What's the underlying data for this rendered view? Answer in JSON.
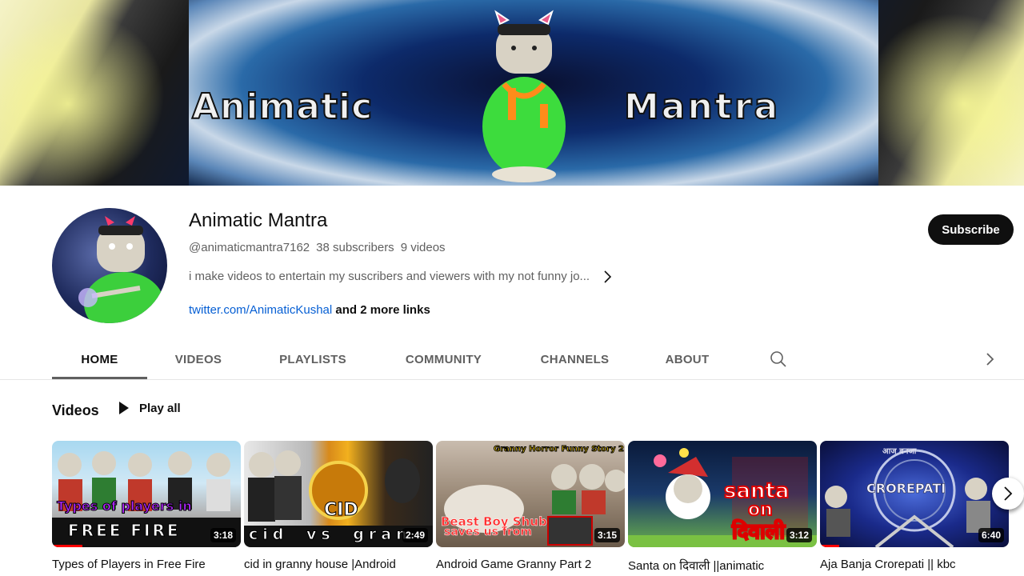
{
  "banner": {
    "word_left": "Animatic",
    "word_right": "Mantra"
  },
  "channel": {
    "name": "Animatic Mantra",
    "handle": "@animaticmantra7162",
    "subscribers": "38 subscribers",
    "videos_count": "9 videos",
    "description": "i make videos to entertain my suscribers and viewers with my not funny jo...",
    "link_text": "twitter.com/AnimaticKushal",
    "more_links": "and 2 more links",
    "subscribe_label": "Subscribe"
  },
  "tabs": [
    {
      "label": "HOME",
      "active": true
    },
    {
      "label": "VIDEOS"
    },
    {
      "label": "PLAYLISTS"
    },
    {
      "label": "COMMUNITY"
    },
    {
      "label": "CHANNELS"
    },
    {
      "label": "ABOUT"
    }
  ],
  "section": {
    "title": "Videos",
    "play_all": "Play all"
  },
  "videos": [
    {
      "title": "Types of Players in Free Fire",
      "duration": "3:18",
      "thumb_caption_1": "Types of players in",
      "thumb_caption_2": "FREE FIRE"
    },
    {
      "title": "cid in granny house |Android",
      "duration": "2:49",
      "thumb_caption_1": "cid vs gran",
      "thumb_caption_2": "CID"
    },
    {
      "title": "Android Game Granny Part 2",
      "duration": "3:15",
      "thumb_caption_1": "Beast Boy Shub",
      "thumb_caption_2": "saves us from",
      "thumb_caption_3": "Granny Horror Funny Story 2"
    },
    {
      "title": "Santa on दिवाली ||animatic",
      "duration": "3:12",
      "thumb_caption_1": "santa",
      "thumb_caption_2": "on",
      "thumb_caption_3": "दिवाली"
    },
    {
      "title": "Aja Banja Crorepati || kbc",
      "duration": "6:40",
      "thumb_caption_1": "CROREPATI",
      "thumb_caption_2": "आज बनजा"
    }
  ],
  "colors": {
    "accent": "#065fd4",
    "subscribe_bg": "#0f0f0f",
    "progress": "#ff0000"
  }
}
